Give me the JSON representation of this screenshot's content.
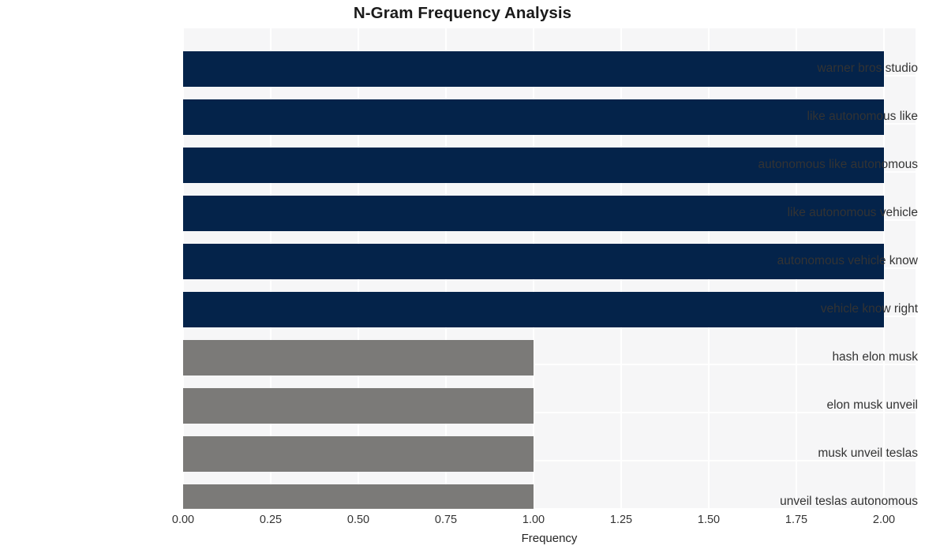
{
  "chart_data": {
    "type": "bar",
    "orientation": "horizontal",
    "title": "N-Gram Frequency Analysis",
    "xlabel": "Frequency",
    "ylabel": "",
    "categories": [
      "warner bros studio",
      "like autonomous like",
      "autonomous like autonomous",
      "like autonomous vehicle",
      "autonomous vehicle know",
      "vehicle know right",
      "hash elon musk",
      "elon musk unveil",
      "musk unveil teslas",
      "unveil teslas autonomous"
    ],
    "values": [
      2,
      2,
      2,
      2,
      2,
      2,
      1,
      1,
      1,
      1
    ],
    "bar_colors": [
      "#04234a",
      "#04234a",
      "#04234a",
      "#04234a",
      "#04234a",
      "#04234a",
      "#7b7a78",
      "#7b7a78",
      "#7b7a78",
      "#7b7a78"
    ],
    "xlim": [
      0,
      2.0
    ],
    "xticks": [
      0,
      0.25,
      0.5,
      0.75,
      1.0,
      1.25,
      1.5,
      1.75,
      2.0
    ],
    "xtick_labels": [
      "0.00",
      "0.25",
      "0.50",
      "0.75",
      "1.00",
      "1.25",
      "1.50",
      "1.75",
      "2.00"
    ],
    "grid": true,
    "legend": null,
    "plot_background": "#f6f6f7",
    "figure_background": "#ffffff",
    "gridline_color": "#ffffff"
  }
}
